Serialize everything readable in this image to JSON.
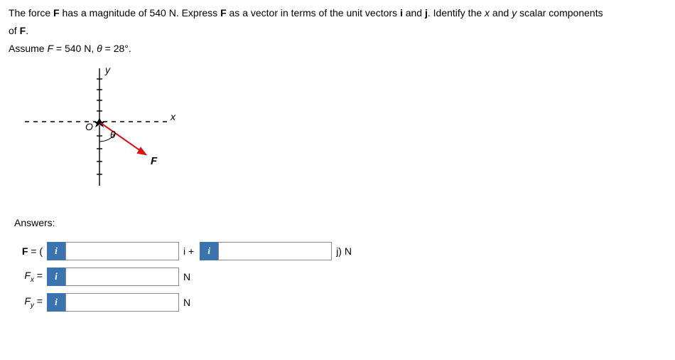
{
  "problem": {
    "line1_pre": "The force ",
    "F": "F",
    "line1_mid1": " has a magnitude of 540 N. Express ",
    "line1_mid2": " as a vector in terms of the unit vectors ",
    "i": "i",
    "and": " and ",
    "j": "j",
    "line1_end": ". Identify the ",
    "x": "x",
    "and2": " and ",
    "y": "y",
    "line1_tail": " scalar components",
    "line2": "of ",
    "line2_end": ".",
    "assume_pre": "Assume ",
    "assume_F": "F",
    "assume_eq": " = 540 N, ",
    "theta": "θ",
    "assume_val": " = 28°."
  },
  "diagram": {
    "y_label": "y",
    "x_label": "x",
    "O_label": "O",
    "theta_label": "θ",
    "F_label": "F"
  },
  "answers": {
    "heading": "Answers:",
    "F_label_pre": "F",
    "F_label_eqopen": " = ( ",
    "i_plus": " i + ",
    "j_close_unit": " j) N",
    "Fx_label": "F",
    "Fx_sub": "x",
    "Fy_label": "F",
    "Fy_sub": "y",
    "eq_sign": " = ",
    "unit_N": "N",
    "info_icon": "i",
    "input_placeholder": ""
  }
}
